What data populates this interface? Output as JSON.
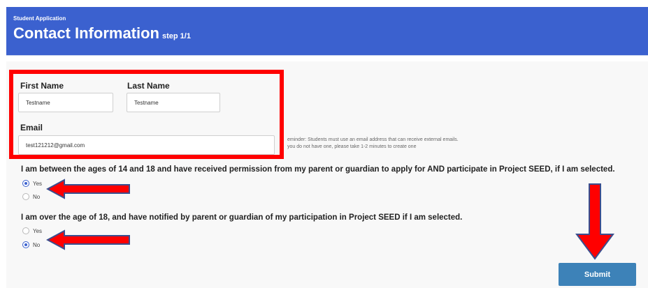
{
  "header": {
    "subtitle": "Student Application",
    "title": "Contact Information",
    "step": "step 1/1",
    "bg_color": "#3b61cf"
  },
  "form": {
    "first_name": {
      "label": "First Name",
      "value": "Testname"
    },
    "last_name": {
      "label": "Last Name",
      "value": "Testname"
    },
    "email": {
      "label": "Email",
      "value": "test121212@gmail.com"
    },
    "email_note_line1": "eminder: Students must use an email address that can receive external emails.",
    "email_note_line2": "you do not have one, please take 1-2 minutes to create one"
  },
  "questions": [
    {
      "text": "I am between the ages of 14 and 18 and have received permission from my parent or guardian to apply for AND participate in Project SEED, if I am selected.",
      "options": [
        "Yes",
        "No"
      ],
      "selected": "Yes"
    },
    {
      "text": "I am over the age of 18, and have notified by parent or guardian of my participation in Project SEED if I am selected.",
      "options": [
        "Yes",
        "No"
      ],
      "selected": "No"
    }
  ],
  "submit_label": "Submit",
  "annotation_color": "#ff0000",
  "arrow_outline_color": "#3a4f8f"
}
